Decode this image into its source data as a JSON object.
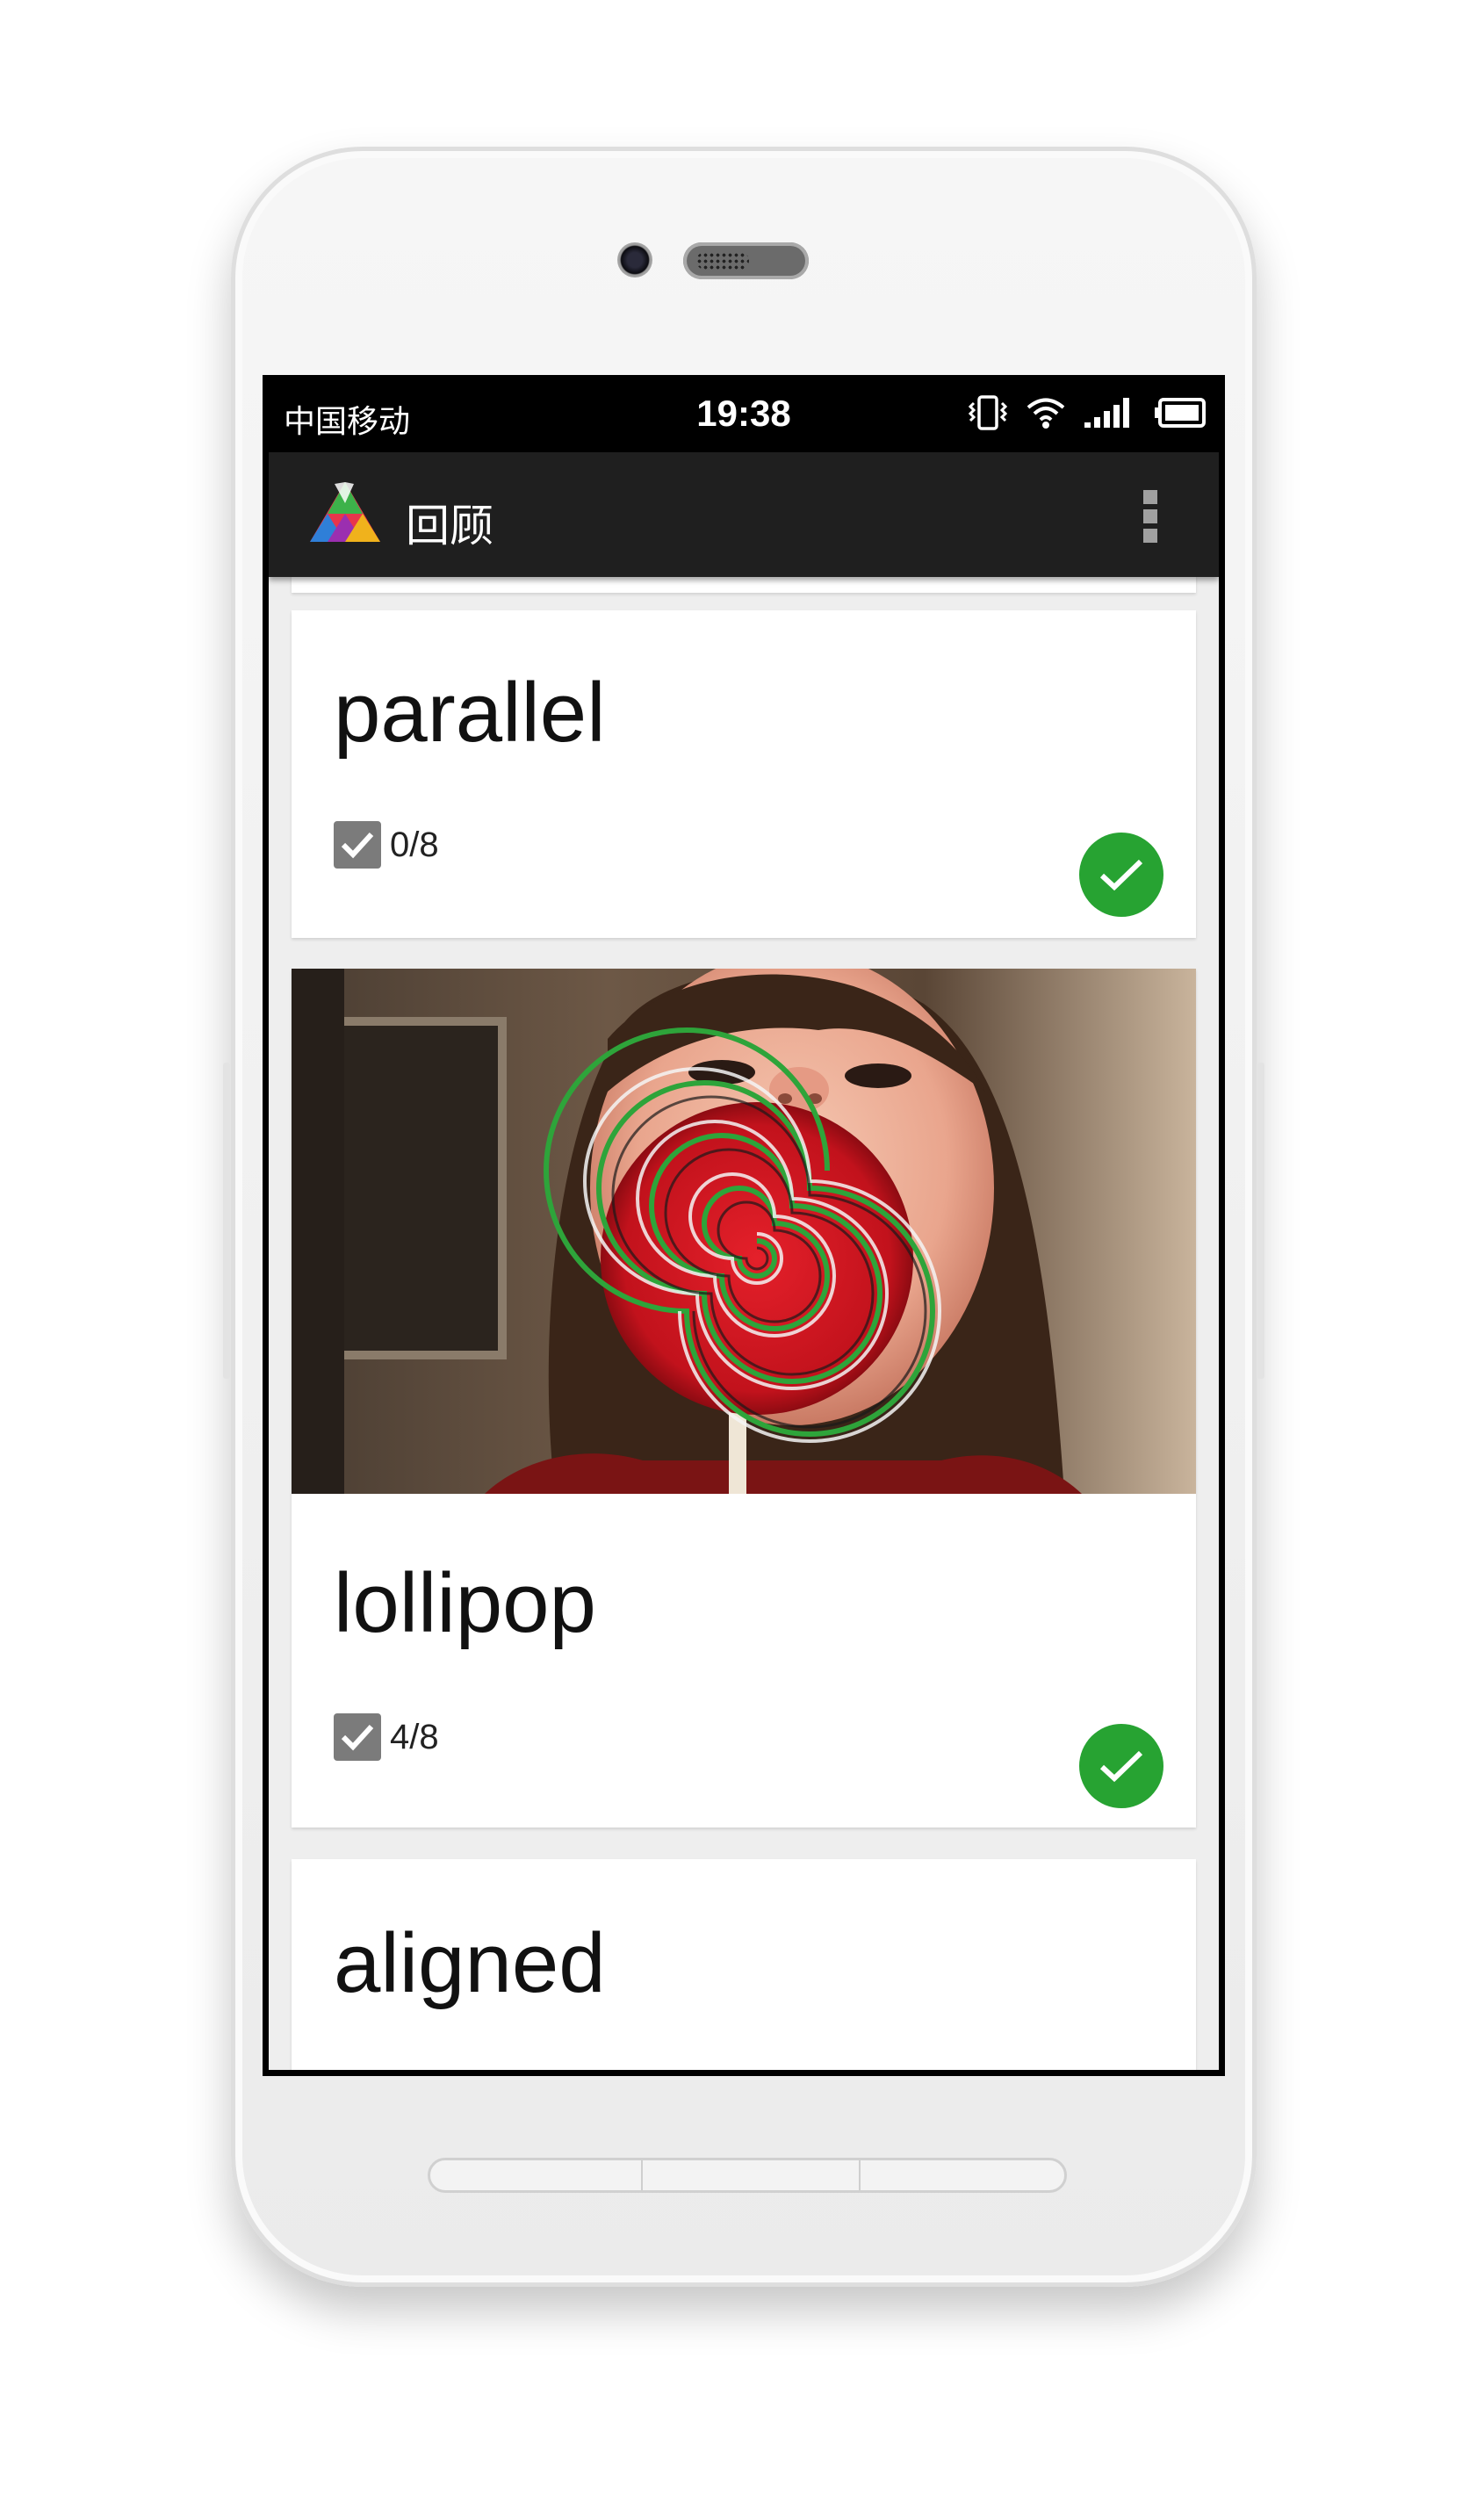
{
  "status_bar": {
    "carrier": "中国移动",
    "time": "19:38",
    "icons": [
      "vibrate-icon",
      "wifi-icon",
      "signal-icon",
      "battery-icon"
    ]
  },
  "app_bar": {
    "title": "回顾",
    "logo_icon": "app-logo-icon",
    "menu_icon": "overflow-menu-icon"
  },
  "cards": [
    {
      "word": "parallel",
      "count": "0/8",
      "has_image": false,
      "image_subject": "",
      "done": true
    },
    {
      "word": "lollipop",
      "count": "4/8",
      "has_image": true,
      "image_subject": "child-with-lollipop",
      "done": true
    },
    {
      "word": "aligned",
      "count": "",
      "has_image": false,
      "image_subject": "",
      "done": false
    }
  ],
  "colors": {
    "app_bar": "#1f1f1f",
    "status_bar": "#000000",
    "background": "#eeeeee",
    "done_badge": "#27a332",
    "checkbox": "#7b7b7b"
  }
}
